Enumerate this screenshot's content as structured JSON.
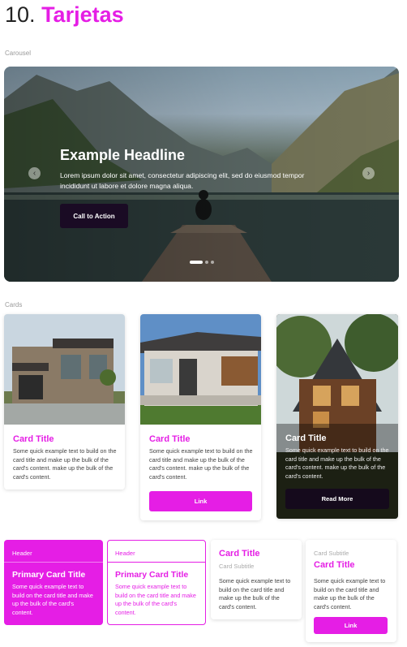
{
  "page": {
    "number": "10.",
    "title": "Tarjetas"
  },
  "sections": {
    "carousel": "Carousel",
    "cards": "Cards"
  },
  "carousel": {
    "headline": "Example Headline",
    "body": "Lorem ipsum dolor sit amet, consectetur adipiscing elit, sed do eiusmod tempor incididunt ut labore et dolore magna aliqua.",
    "cta": "Call to Action",
    "prev_icon": "‹",
    "next_icon": "›"
  },
  "cards": [
    {
      "title": "Card Title",
      "text": "Some quick example text to build on the card title and make up the bulk of the card's content.  make up the bulk of the card's content."
    },
    {
      "title": "Card Title",
      "text": "Some quick example text to build on the card title and make up the bulk of the card's content.  make up the bulk of the card's content.",
      "button": "Link"
    },
    {
      "title": "Card Title",
      "text": "Some quick example text to build on the card title and make up the bulk of the card's content.  make up the bulk of the card's content.",
      "button": "Read More"
    }
  ],
  "bottom_cards": [
    {
      "header": "Header",
      "title": "Primary Card Title",
      "text": "Some quick example text to build on the card title and make up the bulk of the card's content."
    },
    {
      "header": "Header",
      "title": "Primary Card Title",
      "text": "Some quick example text to build on the card title and make up the bulk of the card's content."
    },
    {
      "title": "Card Title",
      "subtitle": "Card Subtitle",
      "text": "Some quick example text to build on the card title and make up the bulk of the card's content."
    },
    {
      "subtitle": "Card Subtitle",
      "title": "Card Title",
      "text": "Some quick example text to build on the card title and make up the bulk of the card's content.",
      "button": "Link"
    }
  ],
  "colors": {
    "accent": "#e51ee5",
    "dark": "#150a1c"
  }
}
